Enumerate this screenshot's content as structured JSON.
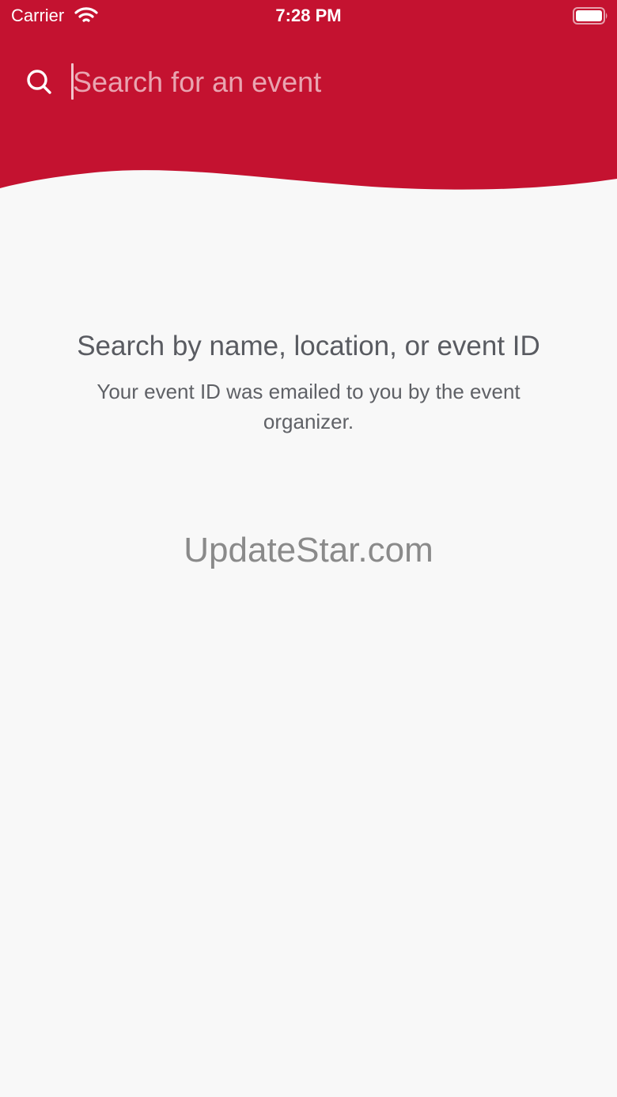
{
  "status_bar": {
    "carrier": "Carrier",
    "time": "7:28 PM",
    "wifi_icon": "wifi-icon",
    "battery_icon": "battery-full-icon"
  },
  "header": {
    "background_color": "#c41230",
    "search": {
      "placeholder": "Search for an event",
      "value": "",
      "icon": "search-icon"
    }
  },
  "empty_state": {
    "title": "Search by name, location, or event ID",
    "subtitle": "Your event ID was emailed to you by the event organizer."
  },
  "watermark": {
    "text": "UpdateStar.com"
  }
}
